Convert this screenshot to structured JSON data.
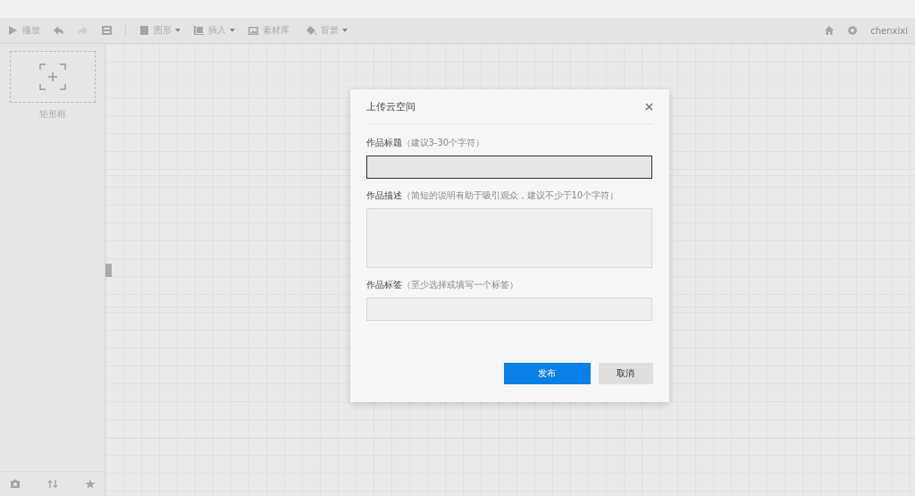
{
  "toolbar": {
    "left": [
      {
        "kind": "play",
        "label": "播放"
      },
      {
        "kind": "undo"
      },
      {
        "kind": "redo",
        "disabled": true
      },
      {
        "kind": "save"
      },
      {
        "kind": "shape",
        "label": "图形",
        "dropdown": true
      },
      {
        "kind": "insert",
        "label": "插入",
        "dropdown": true
      },
      {
        "kind": "library",
        "label": "素材库",
        "dropdown": false
      },
      {
        "kind": "background",
        "label": "背景",
        "dropdown": true
      }
    ],
    "user": "chenxixi"
  },
  "sidebar": {
    "frame_label": "矩形框"
  },
  "dialog": {
    "title": "上传云空间",
    "fields": [
      {
        "kind": "input",
        "label": "作品标题",
        "hint": "（建议3-30个字符）",
        "focused": true
      },
      {
        "kind": "textarea",
        "label": "作品描述",
        "hint": "（简短的说明有助于吸引观众，建议不少于10个字符）",
        "focused": false
      },
      {
        "kind": "input",
        "label": "作品标签",
        "hint": "（至少选择或填写一个标签）",
        "focused": false
      }
    ],
    "buttons": [
      {
        "kind": "primary",
        "label": "发布"
      },
      {
        "kind": "secondary",
        "label": "取消"
      }
    ]
  }
}
